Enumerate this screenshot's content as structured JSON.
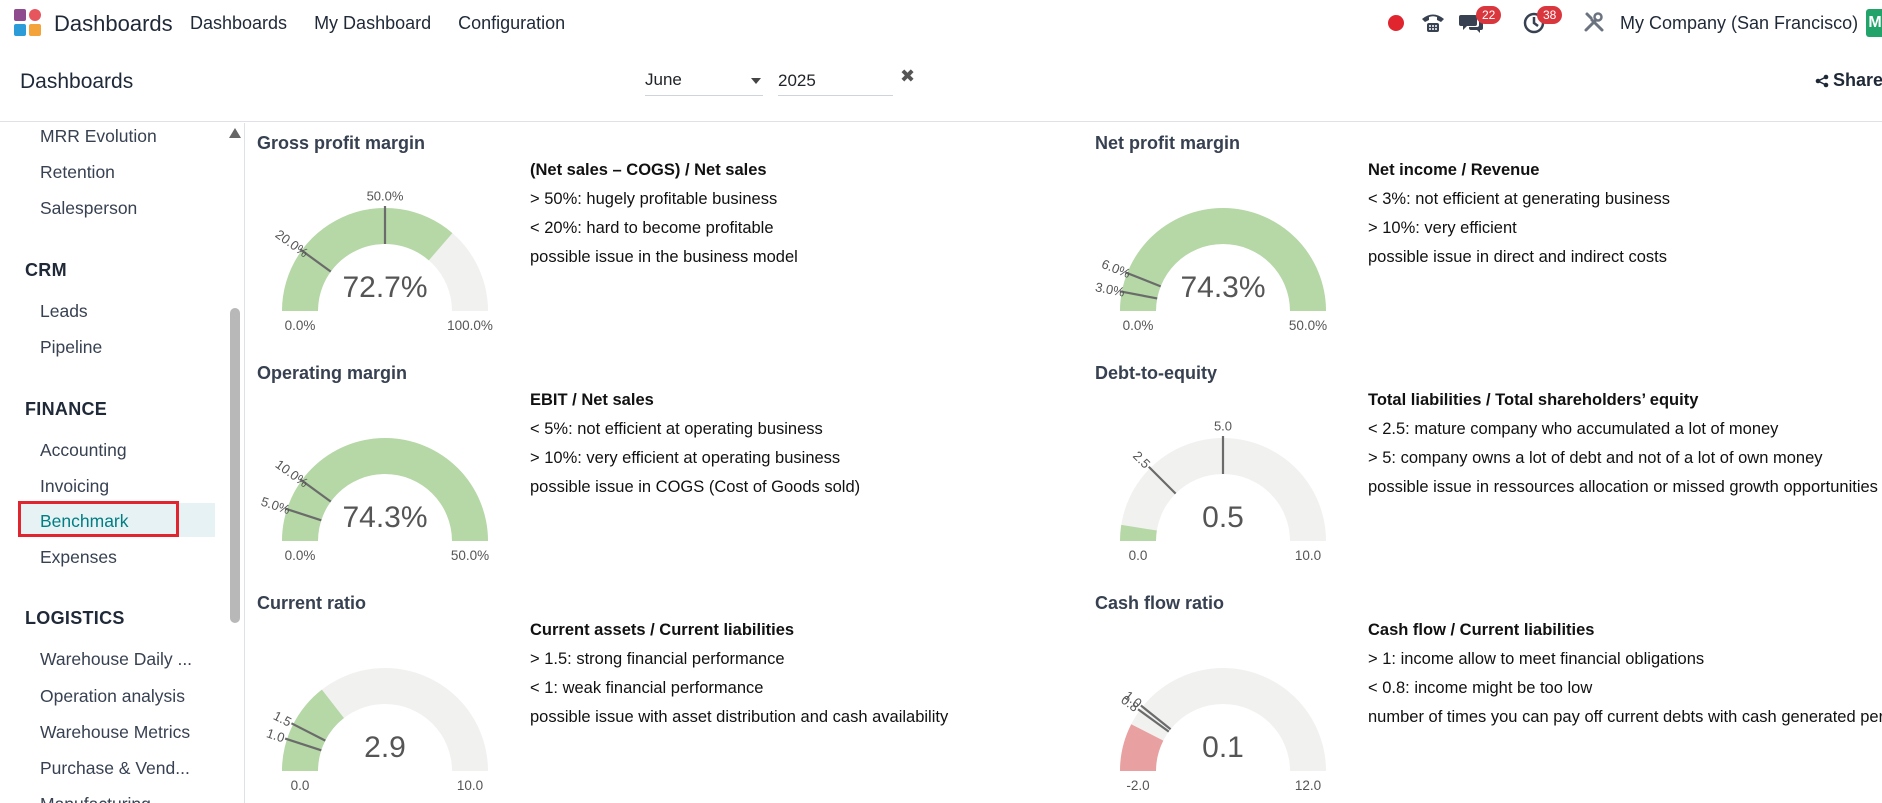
{
  "app": {
    "name": "Dashboards",
    "menu": [
      "Dashboards",
      "My Dashboard",
      "Configuration"
    ],
    "company": "My Company (San Francisco)",
    "avatar_letter": "M",
    "messages_count": "22",
    "activities_count": "38"
  },
  "control": {
    "title": "Dashboards",
    "month": "June",
    "year": "2025",
    "share_label": "Share"
  },
  "sidebar": {
    "groups": [
      {
        "items": [
          "MRR Evolution",
          "Retention",
          "Salesperson"
        ]
      },
      {
        "title": "CRM",
        "items": [
          "Leads",
          "Pipeline"
        ]
      },
      {
        "title": "FINANCE",
        "items": [
          "Accounting",
          "Invoicing",
          "Benchmark",
          "Expenses"
        ]
      },
      {
        "title": "LOGISTICS",
        "items": [
          "Warehouse Daily ...",
          "Operation analysis",
          "Warehouse Metrics",
          "Purchase & Vend...",
          "Manufacturing"
        ]
      }
    ],
    "active": "Benchmark"
  },
  "cards": [
    {
      "title": "Gross profit margin",
      "value": 72.7,
      "value_label": "72.7%",
      "min": 0,
      "max": 100,
      "min_label": "0.0%",
      "max_label": "100.0%",
      "thresholds": [
        {
          "v": 20,
          "label": "20.0%"
        },
        {
          "v": 50,
          "label": "50.0%"
        }
      ],
      "color": "#b5d8a6",
      "formula": "(Net sales – COGS) / Net sales",
      "lines": [
        "> 50%: hugely profitable business",
        "< 20%: hard to become profitable",
        "possible issue in the business model"
      ]
    },
    {
      "title": "Net profit margin",
      "value": 74.3,
      "value_label": "74.3%",
      "min": 0,
      "max": 50,
      "min_label": "0.0%",
      "max_label": "50.0%",
      "thresholds": [
        {
          "v": 3,
          "label": "3.0%"
        },
        {
          "v": 6,
          "label": "6.0%"
        }
      ],
      "color": "#b5d8a6",
      "formula": "Net income / Revenue",
      "lines": [
        "< 3%: not efficient at generating business",
        "> 10%: very efficient",
        "possible issue in direct and indirect costs"
      ]
    },
    {
      "title": "Operating margin",
      "value": 74.3,
      "value_label": "74.3%",
      "min": 0,
      "max": 50,
      "min_label": "0.0%",
      "max_label": "50.0%",
      "thresholds": [
        {
          "v": 5,
          "label": "5.0%"
        },
        {
          "v": 10,
          "label": "10.0%"
        }
      ],
      "color": "#b5d8a6",
      "formula": "EBIT / Net sales",
      "lines": [
        "< 5%: not efficient at operating business",
        "> 10%: very efficient at operating business",
        "possible issue in COGS (Cost of Goods sold)"
      ]
    },
    {
      "title": "Debt-to-equity",
      "value": 0.5,
      "value_label": "0.5",
      "min": 0,
      "max": 10,
      "min_label": "0.0",
      "max_label": "10.0",
      "thresholds": [
        {
          "v": 2.5,
          "label": "2.5"
        },
        {
          "v": 5,
          "label": "5.0"
        }
      ],
      "color": "#b5d8a6",
      "formula": "Total liabilities / Total shareholders’ equity",
      "lines": [
        "< 2.5: mature company who accumulated a lot of money",
        "> 5: company owns a lot of debt and not of a lot of own money",
        "possible issue in ressources allocation or missed growth opportunities"
      ]
    },
    {
      "title": "Current ratio",
      "value": 2.9,
      "value_label": "2.9",
      "min": 0,
      "max": 10,
      "min_label": "0.0",
      "max_label": "10.0",
      "thresholds": [
        {
          "v": 1,
          "label": "1.0"
        },
        {
          "v": 1.5,
          "label": "1.5"
        }
      ],
      "color": "#b5d8a6",
      "formula": "Current assets / Current liabilities",
      "lines": [
        "> 1.5: strong financial performance",
        "< 1: weak financial performance",
        "possible issue with asset distribution and cash availability"
      ]
    },
    {
      "title": "Cash flow ratio",
      "value": 0.1,
      "value_label": "0.1",
      "min": -2,
      "max": 12,
      "min_label": "-2.0",
      "max_label": "12.0",
      "thresholds": [
        {
          "v": 0.8,
          "label": "0.8"
        },
        {
          "v": 1,
          "label": "1.0"
        }
      ],
      "color": "#e8a0a0",
      "formula": "Cash flow / Current liabilities",
      "lines": [
        "> 1: income allow to meet financial obligations",
        "< 0.8: income might be too low",
        "number of times you can pay off current debts with cash generated per year"
      ]
    }
  ]
}
